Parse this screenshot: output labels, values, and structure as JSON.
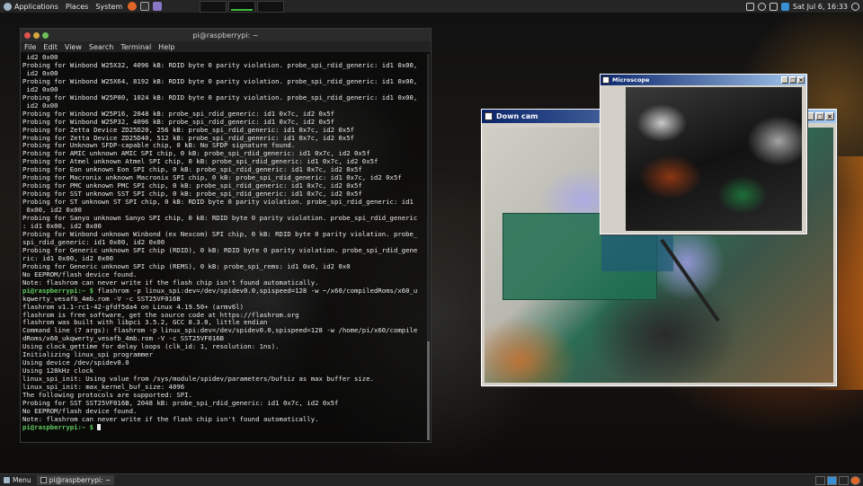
{
  "top_panel": {
    "applications": "Applications",
    "places": "Places",
    "system": "System",
    "clock": "Sat Jul 6, 16:33"
  },
  "terminal": {
    "title": "pi@raspberrypi: ~",
    "menu": [
      "File",
      "Edit",
      "View",
      "Search",
      "Terminal",
      "Help"
    ],
    "lines": [
      {
        "t": " id2 0x00"
      },
      {
        "t": "Probing for Winbond W25X32, 4096 kB: RDID byte 0 parity violation. probe_spi_rdid_generic: id1 0x00,"
      },
      {
        "t": " id2 0x00"
      },
      {
        "t": "Probing for Winbond W25X64, 8192 kB: RDID byte 0 parity violation. probe_spi_rdid_generic: id1 0x00,"
      },
      {
        "t": " id2 0x00"
      },
      {
        "t": "Probing for Winbond W25P80, 1024 kB: RDID byte 0 parity violation. probe_spi_rdid_generic: id1 0x00,"
      },
      {
        "t": " id2 0x00"
      },
      {
        "t": "Probing for Winbond W25P16, 2048 kB: probe_spi_rdid_generic: id1 0x7c, id2 0x5f"
      },
      {
        "t": "Probing for Winbond W25P32, 4096 kB: probe_spi_rdid_generic: id1 0x7c, id2 0x5f"
      },
      {
        "t": "Probing for Zetta Device ZD25D20, 256 kB: probe_spi_rdid_generic: id1 0x7c, id2 0x5f"
      },
      {
        "t": "Probing for Zetta Device ZD25D40, 512 kB: probe_spi_rdid_generic: id1 0x7c, id2 0x5f"
      },
      {
        "t": "Probing for Unknown SFDP-capable chip, 0 kB: No SFDP signature found."
      },
      {
        "t": "Probing for AMIC unknown AMIC SPI chip, 0 kB: probe_spi_rdid_generic: id1 0x7c, id2 0x5f"
      },
      {
        "t": "Probing for Atmel unknown Atmel SPI chip, 0 kB: probe_spi_rdid_generic: id1 0x7c, id2 0x5f"
      },
      {
        "t": "Probing for Eon unknown Eon SPI chip, 0 kB: probe_spi_rdid_generic: id1 0x7c, id2 0x5f"
      },
      {
        "t": "Probing for Macronix unknown Macronix SPI chip, 0 kB: probe_spi_rdid_generic: id1 0x7c, id2 0x5f"
      },
      {
        "t": "Probing for PMC unknown PMC SPI chip, 0 kB: probe_spi_rdid_generic: id1 0x7c, id2 0x5f"
      },
      {
        "t": "Probing for SST unknown SST SPI chip, 0 kB: probe_spi_rdid_generic: id1 0x7c, id2 0x5f"
      },
      {
        "t": "Probing for ST unknown ST SPI chip, 0 kB: RDID byte 0 parity violation. probe_spi_rdid_generic: id1"
      },
      {
        "t": " 0x00, id2 0x00"
      },
      {
        "t": "Probing for Sanyo unknown Sanyo SPI chip, 0 kB: RDID byte 0 parity violation. probe_spi_rdid_generic"
      },
      {
        "t": ": id1 0x00, id2 0x00"
      },
      {
        "t": "Probing for Winbond unknown Winbond (ex Nexcom) SPI chip, 0 kB: RDID byte 0 parity violation. probe_"
      },
      {
        "t": "spi_rdid_generic: id1 0x00, id2 0x00"
      },
      {
        "t": "Probing for Generic unknown SPI chip (RDID), 0 kB: RDID byte 0 parity violation. probe_spi_rdid_gene"
      },
      {
        "t": "ric: id1 0x00, id2 0x00"
      },
      {
        "t": "Probing for Generic unknown SPI chip (REMS), 0 kB: probe_spi_rems: id1 0x0, id2 0x0"
      },
      {
        "t": "No EEPROM/flash device found."
      },
      {
        "t": "Note: flashrom can never write if the flash chip isn't found automatically."
      },
      {
        "p": "pi@raspberrypi:~ $",
        "t": " flashrom -p linux_spi:dev=/dev/spidev0.0,spispeed=128 -w ~/x60/compiledRoms/x60_u"
      },
      {
        "t": "kqwerty_vesafb_4mb.rom -V -c SST25VF016B"
      },
      {
        "t": "flashrom v1.1-rc1-42-gfdf5da4 on Linux 4.19.50+ (armv6l)"
      },
      {
        "t": "flashrom is free software, get the source code at https://flashrom.org"
      },
      {
        "t": ""
      },
      {
        "t": "flashrom was built with libpci 3.5.2, GCC 8.3.0, little endian"
      },
      {
        "t": "Command line (7 args): flashrom -p linux_spi:dev=/dev/spidev0.0,spispeed=128 -w /home/pi/x60/compile"
      },
      {
        "t": "dRoms/x60_ukqwerty_vesafb_4mb.rom -V -c SST25VF016B"
      },
      {
        "t": "Using clock_gettime for delay loops (clk_id: 1, resolution: 1ns)."
      },
      {
        "t": "Initializing linux_spi programmer"
      },
      {
        "t": "Using device /dev/spidev0.0"
      },
      {
        "t": "Using 128kHz clock"
      },
      {
        "t": "linux_spi_init: Using value from /sys/module/spidev/parameters/bufsiz as max buffer size."
      },
      {
        "t": "linux_spi_init: max_kernel_buf_size: 4096"
      },
      {
        "t": "The following protocols are supported: SPI."
      },
      {
        "t": "Probing for SST SST25VF016B, 2048 kB: probe_spi_rdid_generic: id1 0x7c, id2 0x5f"
      },
      {
        "t": "No EEPROM/flash device found."
      },
      {
        "t": "Note: flashrom can never write if the flash chip isn't found automatically."
      },
      {
        "p": "pi@raspberrypi:~ $",
        "t": " ",
        "cursor": true
      }
    ]
  },
  "down_cam": {
    "title": "Down cam"
  },
  "microscope": {
    "title": "Microscope"
  },
  "taskbar": {
    "menu": "Menu",
    "task": "pi@raspberrypi: ~"
  },
  "colors": {
    "prompt": "#5ec85e",
    "xp_title_start": "#0a246a",
    "xp_title_end": "#a6caf0"
  }
}
